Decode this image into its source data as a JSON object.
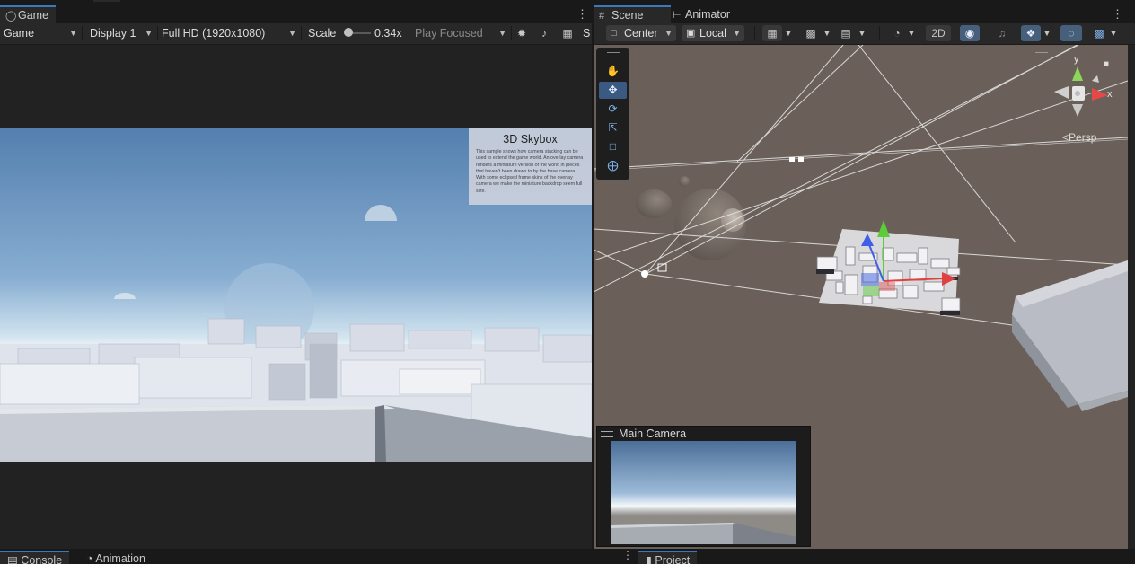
{
  "game": {
    "tab_label": "Game",
    "toolbar": {
      "view_mode": "Game",
      "display": "Display 1",
      "resolution": "Full HD (1920x1080)",
      "scale_label": "Scale",
      "scale_value": "0.34x",
      "scale_fraction": 0.1,
      "play_mode": "Play Focused",
      "stats_label": "S"
    },
    "info_panel": {
      "title": "3D Skybox",
      "description": "This sample shows how camera stacking can be used to extend the game world. An overlay camera renders a miniature version of the world in pieces that haven't been drawn to by the base camera. With some eclipsed frame skins of the overlay camera we make the miniature backdrop seem full size."
    }
  },
  "scene": {
    "tabs": [
      "Scene",
      "Animator"
    ],
    "toolbar": {
      "pivot": "Center",
      "space": "Local",
      "mode_2d": "2D"
    },
    "gizmo": {
      "projection_label": "Persp",
      "axis_y": "y",
      "axis_x": "x"
    },
    "tools": [
      "hand-tool",
      "move-tool",
      "rotate-tool",
      "scale-tool",
      "rect-tool",
      "transform-tool"
    ],
    "camera_preview": {
      "title": "Main Camera"
    }
  },
  "bottom": {
    "tabs": [
      "Console",
      "Animation",
      "Project"
    ]
  },
  "colors": {
    "accent": "#3a79bb",
    "panel": "#282828",
    "background": "#191919",
    "scene_ground": "#6b6059"
  }
}
